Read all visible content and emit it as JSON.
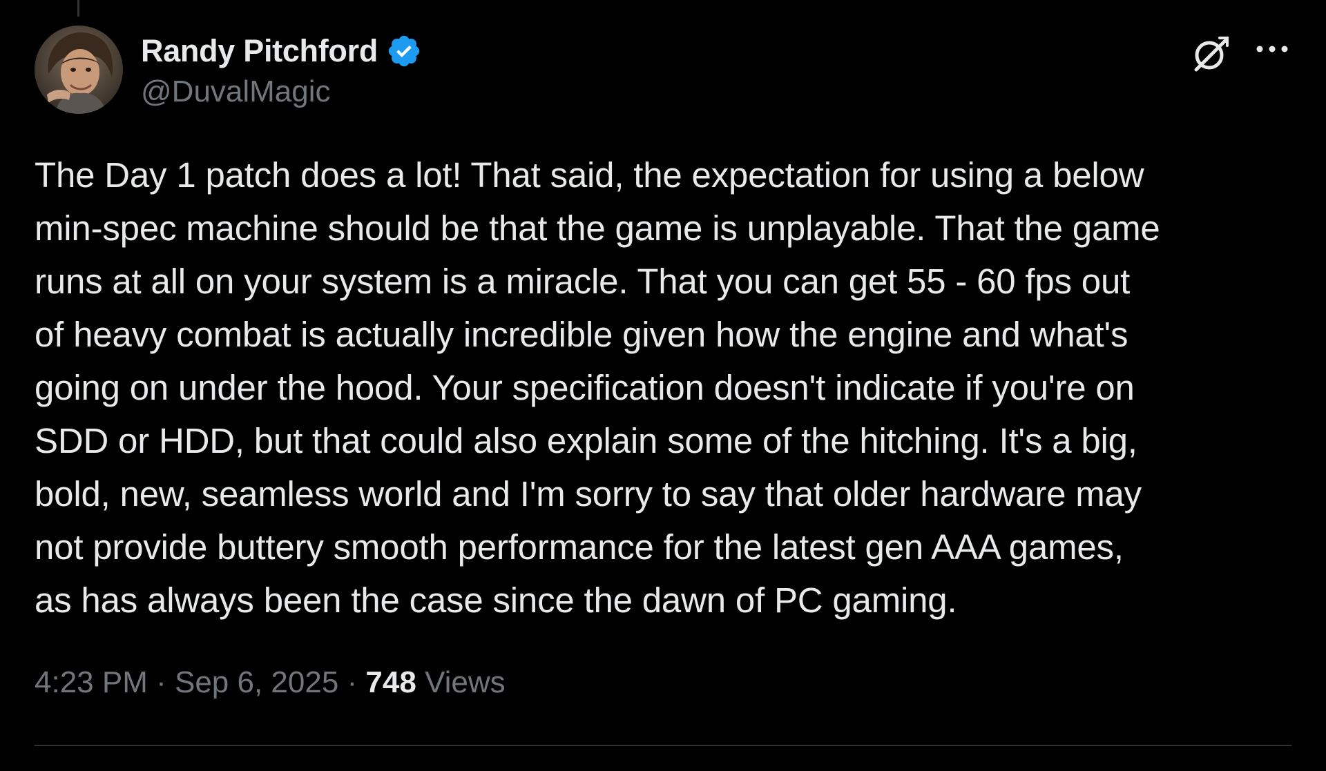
{
  "author": {
    "display_name": "Randy Pitchford",
    "handle": "@DuvalMagic",
    "verified": true,
    "avatar_icon": "profile-photo"
  },
  "actions": {
    "grok_icon": "grok-icon",
    "more_icon": "more-icon"
  },
  "tweet": {
    "text": "The Day 1 patch does a lot! That said, the expectation for using a below\nmin-spec machine should be that the game is unplayable. That the game\nruns at all on your system is a miracle. That you can get 55 - 60 fps out\nof heavy combat is actually incredible given how the engine and what's\ngoing on under the hood. Your specification doesn't indicate if you're on\nSDD or HDD, but that could also explain some of the hitching. It's a big,\nbold, new, seamless world and I'm sorry to say that older hardware may\nnot provide buttery smooth performance for the latest gen AAA games,\nas has always been the case since the dawn of PC gaming."
  },
  "meta": {
    "time": "4:23 PM",
    "separator": " · ",
    "date": "Sep 6, 2025",
    "views_count": "748",
    "views_label": "Views"
  },
  "colors": {
    "background": "#000000",
    "text_primary": "#e7e9ea",
    "text_secondary": "#71767b",
    "verified_badge": "#1d9bf0",
    "divider": "#2f3336"
  }
}
